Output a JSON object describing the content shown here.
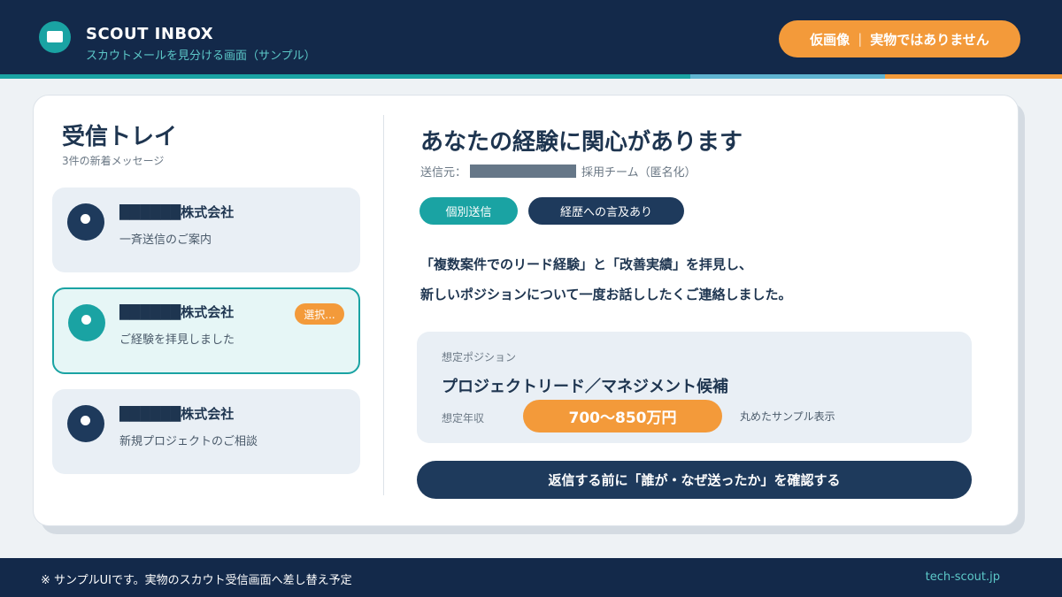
{
  "header": {
    "app_title": "SCOUT INBOX",
    "app_subtitle": "スカウトメールを見分ける画面（サンプル）",
    "logo_icon": "mail-icon",
    "notice_left": "仮画像",
    "notice_right": "実物ではありません"
  },
  "inbox": {
    "title": "受信トレイ",
    "count": "3件の新着メッセージ",
    "messages": [
      {
        "company": "██████株式会社",
        "preview": "一斉送信のご案内",
        "selected": false,
        "badge": ""
      },
      {
        "company": "██████株式会社",
        "preview": "ご経験を拝見しました",
        "selected": true,
        "badge": "選択..."
      },
      {
        "company": "██████株式会社",
        "preview": "新規プロジェクトのご相談",
        "selected": false,
        "badge": ""
      }
    ]
  },
  "mail": {
    "title": "あなたの経験に関心があります",
    "sender_prefix": "送信元：",
    "sender_suffix": "採用チーム（匿名化）",
    "tags": [
      "個別送信",
      "経歴への言及あり"
    ],
    "body_line1": "「複数案件でのリード経験」と「改善実績」を拝見し、",
    "body_line2": "新しいポジションについて一度お話ししたくご連絡しました。",
    "position_label": "想定ポジション",
    "position_title": "プロジェクトリード／マネジメント候補",
    "salary_label": "想定年収",
    "salary_value": "700〜850万円",
    "salary_note": "丸めたサンプル表示",
    "cta_label": "返信する前に「誰が・なぜ送ったか」を確認する"
  },
  "footer": {
    "note": "※ サンプルUIです。実物のスカウト受信画面へ差し替え予定",
    "domain": "tech-scout.jp"
  },
  "colors": {
    "navy": "#13294a",
    "teal": "#1aa3a3",
    "orange": "#f39a3a",
    "text": "#1e3550"
  }
}
